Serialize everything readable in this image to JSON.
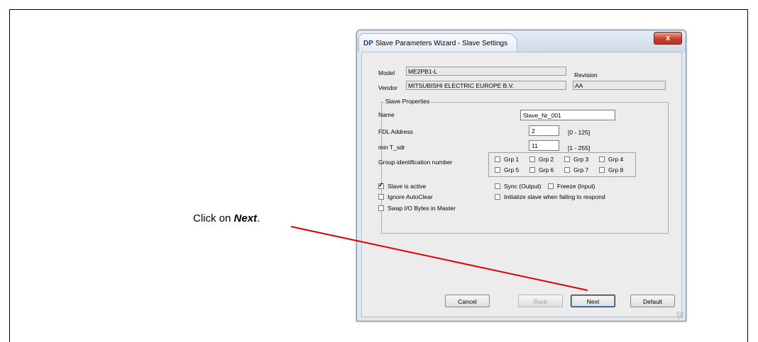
{
  "annotation": {
    "text_prefix": "Click on ",
    "text_bold": "Next",
    "text_suffix": ".",
    "line_color": "#e00000"
  },
  "window": {
    "title_badge": "DP",
    "title": "Slave Parameters Wizard - Slave Settings",
    "close_label": "x"
  },
  "device": {
    "model_label": "Model",
    "model_value": "ME2PB1-L",
    "revision_label": "Revision",
    "vendor_label": "Vendor",
    "vendor_value": "MITSUBISHI ELECTRIC EUROPE B.V.",
    "revision_value": "AA"
  },
  "slave_properties": {
    "legend": "Slave Properties",
    "name_label": "Name",
    "name_value": "Slave_Nr_001",
    "fdl_label": "FDL Address",
    "fdl_value": "2",
    "fdl_range": "[0 - 125]",
    "tsdr_label": "min T_sdr",
    "tsdr_value": "11",
    "tsdr_range": "[1 - 255]",
    "group_label": "Group identification number",
    "groups": [
      "Grp 1",
      "Grp 2",
      "Grp 3",
      "Grp 4",
      "Grp 5",
      "Grp 6",
      "Grp 7",
      "Grp 8"
    ],
    "options": {
      "slave_active": {
        "label": "Slave is active",
        "checked": true
      },
      "ignore_autoclear": {
        "label": "Ignore AutoClear",
        "checked": false
      },
      "swap_io": {
        "label": "Swap I/O Bytes in Master",
        "checked": false
      },
      "sync_output": {
        "label": "Sync (Output)",
        "checked": false
      },
      "freeze_input": {
        "label": "Freeze (Input)",
        "checked": false
      },
      "init_slave": {
        "label": "Initialize slave when failing to respond",
        "checked": false
      }
    }
  },
  "buttons": {
    "cancel": "Cancel",
    "back": "Back",
    "next": "Next",
    "default": "Default"
  }
}
